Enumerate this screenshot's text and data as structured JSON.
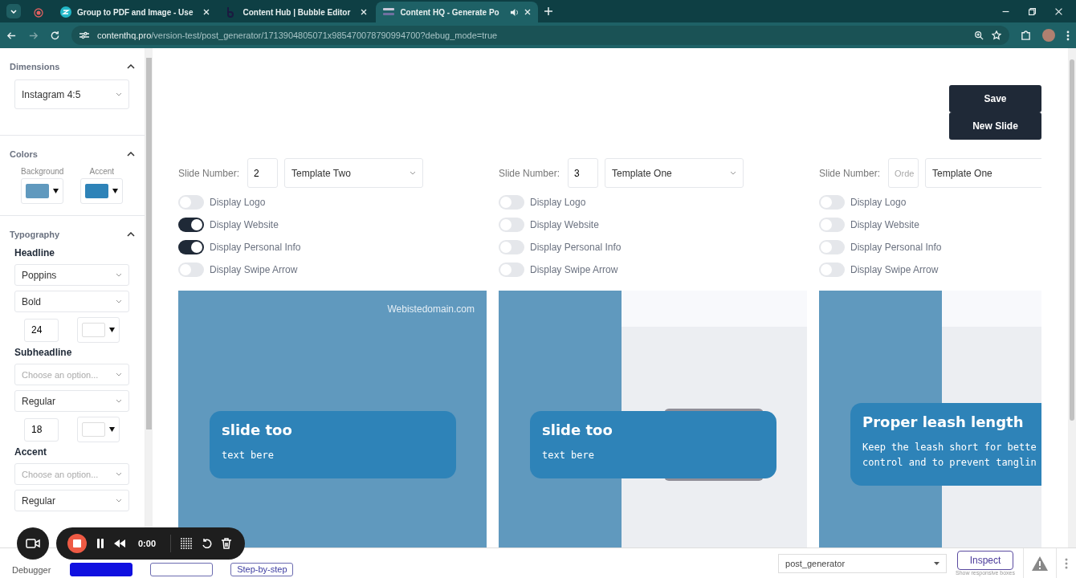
{
  "browser": {
    "tabs": [
      {
        "title": "Group to PDF and Image - Use",
        "kind": "zapier",
        "selected": false,
        "audio": false
      },
      {
        "title": "Content Hub | Bubble Editor",
        "kind": "bubble",
        "selected": false,
        "audio": false
      },
      {
        "title": "Content HQ - Generate Po",
        "kind": "app",
        "selected": true,
        "audio": true
      }
    ],
    "url_host": "contenthq.pro",
    "url_path": "/version-test/post_generator/1713904805071x985470078790994700?debug_mode=true"
  },
  "sidebar": {
    "dimensions": {
      "title": "Dimensions",
      "expanded": true,
      "value": "Instagram 4:5"
    },
    "colors": {
      "title": "Colors",
      "expanded": true,
      "swatches": [
        {
          "label": "Background",
          "color": "#6099be"
        },
        {
          "label": "Accent",
          "color": "#2e83b8"
        }
      ]
    },
    "typography": {
      "title": "Typography",
      "expanded": true,
      "groups": [
        {
          "title": "Headline",
          "font": {
            "value": "Poppins"
          },
          "weight": "Bold",
          "size": "24",
          "color": "#ffffff"
        },
        {
          "title": "Subheadline",
          "font": {
            "placeholder": "Choose an option..."
          },
          "weight": "Regular",
          "size": "18",
          "color": "#ffffff"
        },
        {
          "title": "Accent",
          "font": {
            "placeholder": "Choose an option..."
          },
          "weight": "Regular"
        }
      ]
    }
  },
  "actions": [
    "Save",
    "New Slide"
  ],
  "slides": [
    {
      "number_label": "Slide Number:",
      "number": {
        "value": "2"
      },
      "template": "Template Two",
      "toggles": [
        {
          "label": "Display Logo",
          "on": false
        },
        {
          "label": "Display Website",
          "on": true
        },
        {
          "label": "Display Personal Info",
          "on": true
        },
        {
          "label": "Display Swipe Arrow",
          "on": false
        }
      ],
      "preview": {
        "kind": "full",
        "website": "Webistedomain.com",
        "headline": "slide too",
        "body_lines": [
          "text bere"
        ]
      }
    },
    {
      "number_label": "Slide Number:",
      "number": {
        "value": "3"
      },
      "template": "Template One",
      "toggles": [
        {
          "label": "Display Logo",
          "on": false
        },
        {
          "label": "Display Website",
          "on": false
        },
        {
          "label": "Display Personal Info",
          "on": false
        },
        {
          "label": "Display Swipe Arrow",
          "on": false
        }
      ],
      "preview": {
        "kind": "split",
        "headline": "slide too",
        "body_lines": [
          "text bere"
        ],
        "image_block": true
      }
    },
    {
      "number_label": "Slide Number:",
      "number": {
        "placeholder": "Orde"
      },
      "template": "Template One",
      "toggles": [
        {
          "label": "Display Logo",
          "on": false
        },
        {
          "label": "Display Website",
          "on": false
        },
        {
          "label": "Display Personal Info",
          "on": false
        },
        {
          "label": "Display Swipe Arrow",
          "on": false
        }
      ],
      "preview": {
        "kind": "split",
        "headline": "Proper leash length",
        "body_lines": [
          "Keep the leash short for bette",
          "control and to prevent tanglin"
        ]
      }
    }
  ],
  "recorder": {
    "time": "0:00"
  },
  "debugger": {
    "label": "Debugger",
    "buttons": [
      {
        "kind": "filled"
      },
      {
        "kind": "outline"
      },
      {
        "kind": "outline",
        "label": "Step-by-step"
      }
    ],
    "page_select": "post_generator",
    "inspect": "Inspect",
    "inspect_hint": "Show responsive boxes"
  }
}
